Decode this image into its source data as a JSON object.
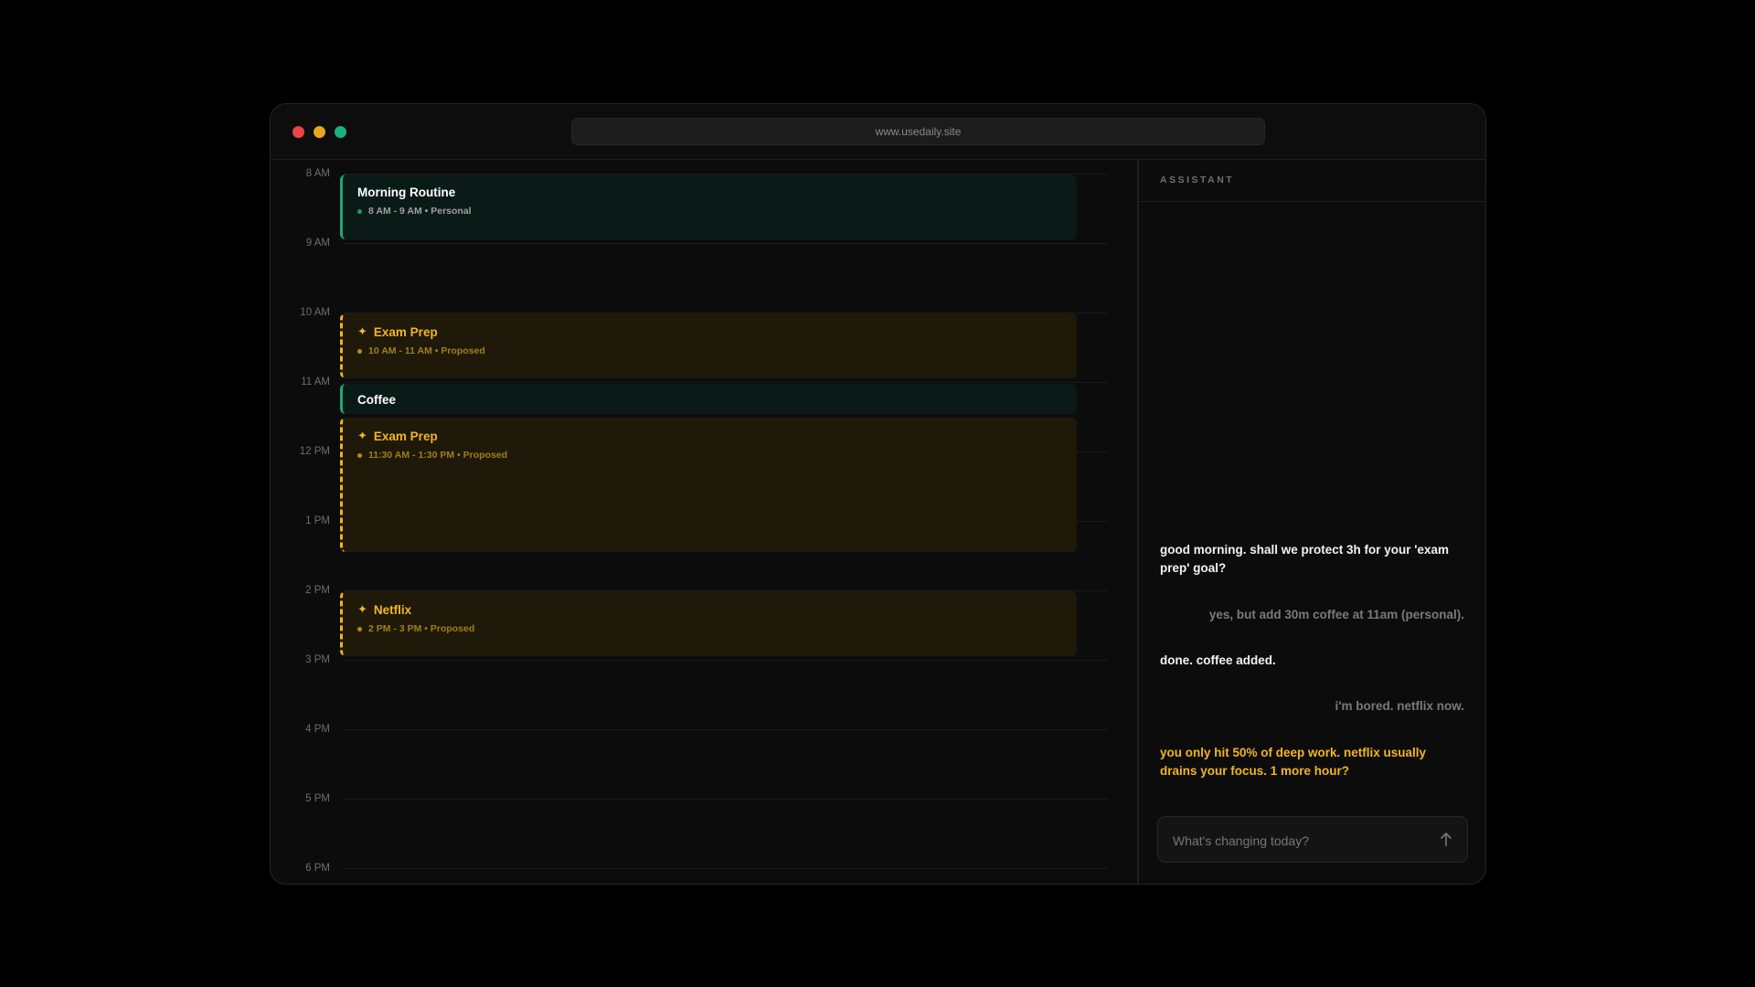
{
  "browser": {
    "url": "www.usedaily.site"
  },
  "calendar": {
    "hours": [
      "8 AM",
      "9 AM",
      "10 AM",
      "11 AM",
      "12 PM",
      "1 PM",
      "2 PM",
      "3 PM",
      "4 PM",
      "5 PM",
      "6 PM"
    ],
    "events": [
      {
        "title": "Morning Routine",
        "meta": "8 AM - 9 AM • Personal",
        "status": "confirmed"
      },
      {
        "title": "Exam Prep",
        "meta": "10 AM - 11 AM • Proposed",
        "status": "proposed"
      },
      {
        "title": "Coffee",
        "meta": "",
        "status": "confirmed"
      },
      {
        "title": "Exam Prep",
        "meta": "11:30 AM - 1:30 PM • Proposed",
        "status": "proposed"
      },
      {
        "title": "Netflix",
        "meta": "2 PM - 3 PM • Proposed",
        "status": "proposed"
      }
    ]
  },
  "assistant": {
    "title": "ASSISTANT",
    "messages": [
      {
        "role": "assistant",
        "text": "good morning. shall we protect 3h for your 'exam prep' goal?"
      },
      {
        "role": "user",
        "text": "yes, but add 30m coffee at 11am (personal)."
      },
      {
        "role": "assistant",
        "text": "done. coffee added."
      },
      {
        "role": "user",
        "text": "i'm bored. netflix now."
      },
      {
        "role": "assistant",
        "text": "you only hit 50% of deep work. netflix usually drains your focus. 1 more hour?",
        "tone": "warning"
      }
    ],
    "input_placeholder": "What's changing today?"
  },
  "colors": {
    "confirmed_accent": "#22a57a",
    "proposed_accent": "#f0b418",
    "warning_text": "#f3b522"
  }
}
